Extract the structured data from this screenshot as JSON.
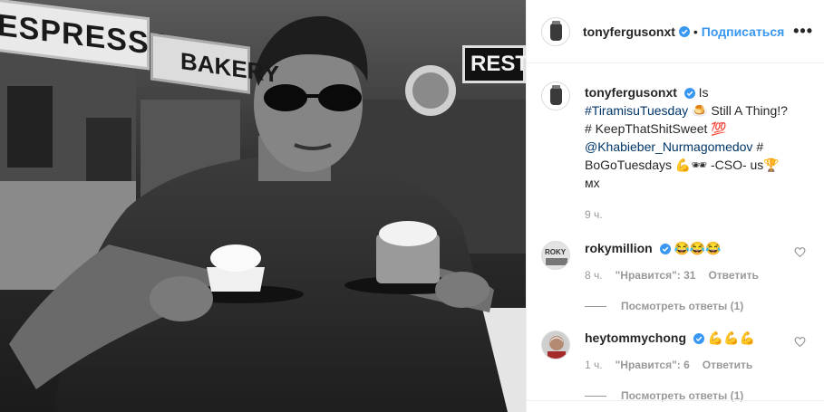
{
  "post": {
    "username": "tonyfergusonxt",
    "follow_label": "Подписаться",
    "dot": "•",
    "more_label": "•••",
    "signs": {
      "espresso": "ESPRESSO",
      "bakery": "BAKERY",
      "resto": "REST"
    },
    "caption": {
      "p1": "Is ",
      "tag1": "#TiramisuTuesday",
      "p2": " 🍮 Still A Thing!? # KeepThatShitSweet 💯 ",
      "mention": "@Khabieber_Nurmagomedov",
      "p3": " # BoGoTuesdays 💪🕶 -CSO- us🏆мх"
    },
    "time": "9 ч."
  },
  "comments": [
    {
      "username": "rokymillion",
      "text": "😂😂😂",
      "time": "8 ч.",
      "likes_label": "\"Нравится\": 31",
      "reply_label": "Ответить",
      "view_replies": "Посмотреть ответы (1)"
    },
    {
      "username": "heytommychong",
      "text": "💪💪💪",
      "time": "1 ч.",
      "likes_label": "\"Нравится\": 6",
      "reply_label": "Ответить",
      "view_replies": "Посмотреть ответы (1)"
    }
  ],
  "colors": {
    "link": "#003569",
    "follow": "#3897f0",
    "verified": "#3897f0",
    "muted": "#999999"
  }
}
